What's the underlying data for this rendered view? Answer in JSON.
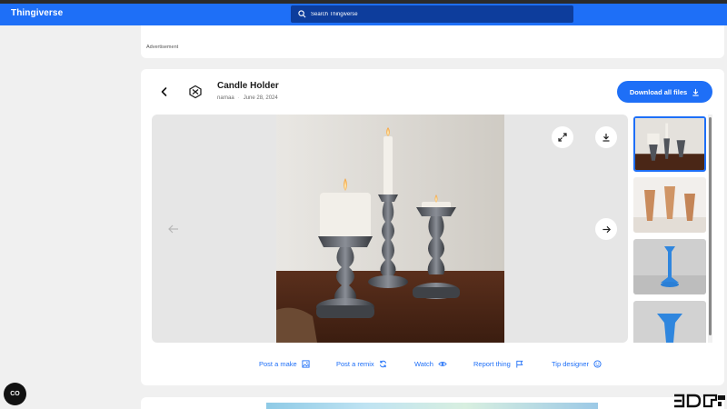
{
  "navbar": {
    "brand": "Thingiverse",
    "search_placeholder": "Search Thingiverse"
  },
  "ad_top": {
    "label": "Advertisement"
  },
  "thing": {
    "title": "Candle Holder",
    "author": "narnaa",
    "date": "June 28, 2024",
    "download_all_label": "Download all files"
  },
  "actions": [
    {
      "label": "Post a make",
      "icon": "image-icon"
    },
    {
      "label": "Post a remix",
      "icon": "refresh-icon"
    },
    {
      "label": "Watch",
      "icon": "eye-icon"
    },
    {
      "label": "Report thing",
      "icon": "flag-icon"
    },
    {
      "label": "Tip designer",
      "icon": "smile-icon"
    }
  ],
  "cookie_button": {
    "label": "CO"
  },
  "colors": {
    "accent": "#1e6ff7",
    "search_bg": "#0d3d9c",
    "page_bg": "#f0f0f0"
  }
}
